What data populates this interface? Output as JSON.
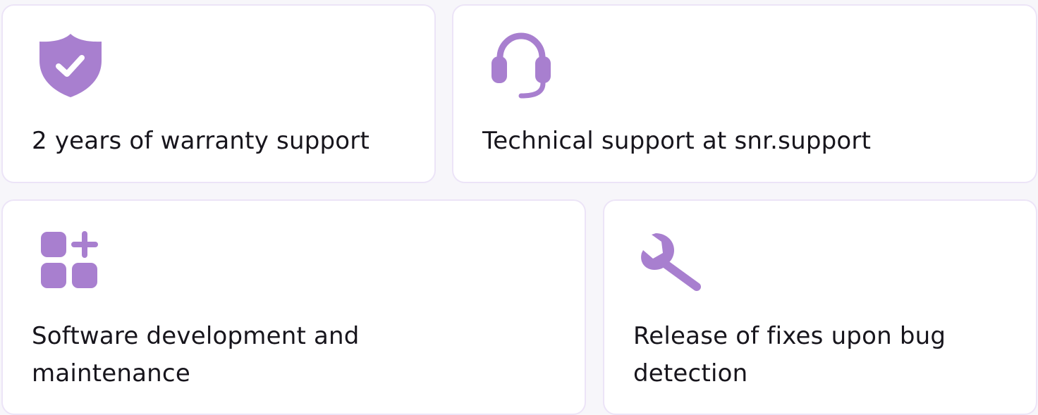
{
  "accent_color": "#a87fcf",
  "features": [
    {
      "icon": "shield-check-icon",
      "label": "2 years of warranty support"
    },
    {
      "icon": "headset-icon",
      "label": "Technical support at snr.support"
    },
    {
      "icon": "apps-add-icon",
      "label": "Software development and maintenance"
    },
    {
      "icon": "wrench-icon",
      "label": "Release of fixes upon bug detection"
    }
  ]
}
